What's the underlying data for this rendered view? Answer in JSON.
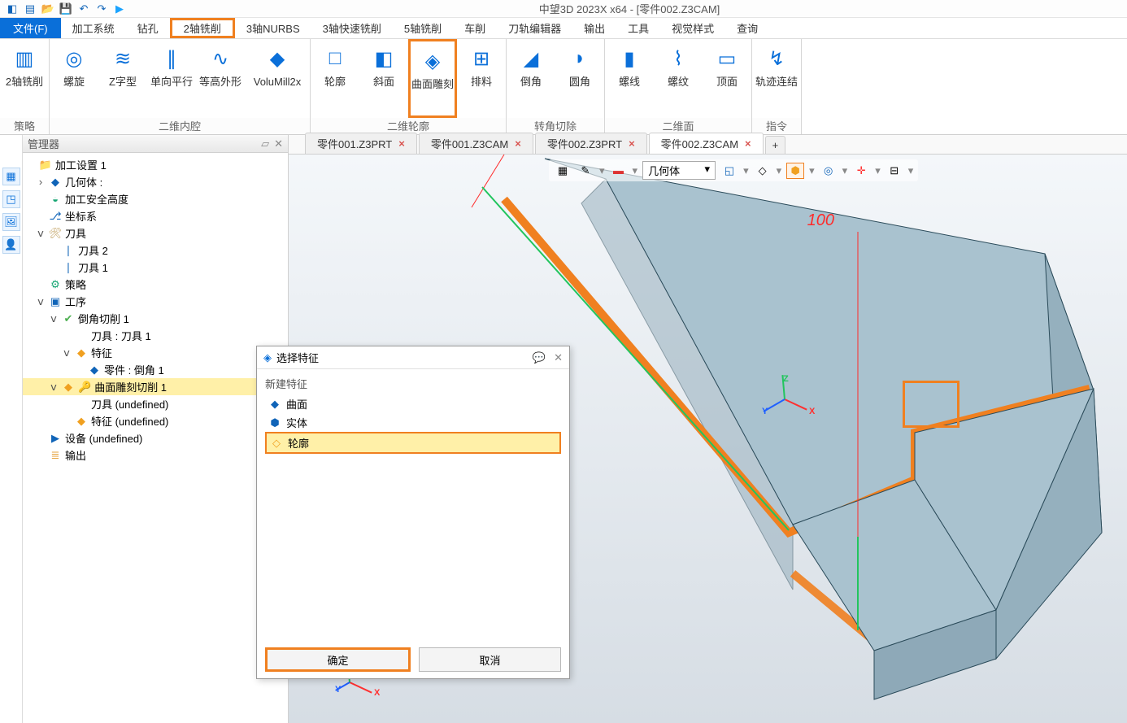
{
  "title": "中望3D 2023X x64 - [零件002.Z3CAM]",
  "file_btn": "文件(F)",
  "menu_tabs": [
    "加工系统",
    "钻孔",
    "2轴铣削",
    "3轴NURBS",
    "3轴快速铣削",
    "5轴铣削",
    "车削",
    "刀轨编辑器",
    "输出",
    "工具",
    "视觉样式",
    "查询"
  ],
  "menu_selected_index": 2,
  "ribbon_groups": [
    {
      "label": "策略",
      "buttons": [
        {
          "cap": "2轴铣削",
          "icon": "▥"
        }
      ]
    },
    {
      "label": "二维内腔",
      "buttons": [
        {
          "cap": "螺旋",
          "icon": "◎"
        },
        {
          "cap": "Z字型",
          "icon": "≋"
        },
        {
          "cap": "单向平行",
          "icon": "∥"
        },
        {
          "cap": "等高外形",
          "icon": "∿"
        },
        {
          "cap": "VoluMill2x",
          "icon": "◆",
          "wide": true
        }
      ]
    },
    {
      "label": "二维轮廓",
      "buttons": [
        {
          "cap": "轮廓",
          "icon": "□"
        },
        {
          "cap": "斜面",
          "icon": "◧"
        },
        {
          "cap": "曲面雕刻",
          "icon": "◈",
          "selected": true
        },
        {
          "cap": "排料",
          "icon": "⊞"
        }
      ]
    },
    {
      "label": "转角切除",
      "buttons": [
        {
          "cap": "倒角",
          "icon": "◢"
        },
        {
          "cap": "圆角",
          "icon": "◗"
        }
      ]
    },
    {
      "label": "二维面",
      "buttons": [
        {
          "cap": "螺线",
          "icon": "▮"
        },
        {
          "cap": "螺纹",
          "icon": "⌇"
        },
        {
          "cap": "顶面",
          "icon": "▭"
        }
      ]
    },
    {
      "label": "指令",
      "buttons": [
        {
          "cap": "轨迹连结",
          "icon": "↯"
        }
      ]
    }
  ],
  "manager_title": "管理器",
  "tree": [
    {
      "d": 0,
      "tw": "",
      "ic": "📁",
      "c": "#e6a23c",
      "t": "加工设置 1"
    },
    {
      "d": 1,
      "tw": "›",
      "ic": "◆",
      "c": "#1064b8",
      "t": "几何体 :"
    },
    {
      "d": 1,
      "tw": "",
      "ic": "◒",
      "c": "#17a673",
      "t": "加工安全高度"
    },
    {
      "d": 1,
      "tw": "",
      "ic": "⎇",
      "c": "#1064b8",
      "t": "坐标系"
    },
    {
      "d": 1,
      "tw": "ⅴ",
      "ic": "🛠",
      "c": "#c0a060",
      "t": "刀具"
    },
    {
      "d": 2,
      "tw": "",
      "ic": "❘",
      "c": "#1064b8",
      "t": "刀具 2"
    },
    {
      "d": 2,
      "tw": "",
      "ic": "❘",
      "c": "#1064b8",
      "t": "刀具 1"
    },
    {
      "d": 1,
      "tw": "",
      "ic": "⚙",
      "c": "#17a673",
      "t": "策略"
    },
    {
      "d": 1,
      "tw": "ⅴ",
      "ic": "▣",
      "c": "#1064b8",
      "t": "工序"
    },
    {
      "d": 2,
      "tw": "ⅴ",
      "ic": "✔",
      "c": "#4caf50",
      "t": "倒角切削 1"
    },
    {
      "d": 3,
      "tw": "",
      "ic": "",
      "c": "",
      "t": "刀具 : 刀具 1"
    },
    {
      "d": 3,
      "tw": "ⅴ",
      "ic": "◆",
      "c": "#f0a020",
      "t": "特征"
    },
    {
      "d": 4,
      "tw": "",
      "ic": "◆",
      "c": "#1064b8",
      "t": "零件 : 倒角 1"
    },
    {
      "d": 2,
      "tw": "ⅴ",
      "ic": "◆",
      "c": "#f0a020",
      "t": "曲面雕刻切削 1",
      "hl": true,
      "extra": "🔑"
    },
    {
      "d": 3,
      "tw": "",
      "ic": "",
      "c": "",
      "t": "刀具 (undefined)"
    },
    {
      "d": 3,
      "tw": "",
      "ic": "◆",
      "c": "#f0a020",
      "t": "特征 (undefined)"
    },
    {
      "d": 1,
      "tw": "",
      "ic": "▶",
      "c": "#1064b8",
      "t": "设备 (undefined)"
    },
    {
      "d": 1,
      "tw": "",
      "ic": "≣",
      "c": "#e6a23c",
      "t": "输出"
    }
  ],
  "doc_tabs": [
    {
      "label": "零件001.Z3PRT",
      "active": false
    },
    {
      "label": "零件001.Z3CAM",
      "active": false
    },
    {
      "label": "零件002.Z3PRT",
      "active": false
    },
    {
      "label": "零件002.Z3CAM",
      "active": true
    }
  ],
  "view_dropdown": "几何体",
  "annotation": "100",
  "dialog": {
    "title": "选择特征",
    "group": "新建特征",
    "items": [
      {
        "icon": "◆",
        "color": "#1064b8",
        "label": "曲面"
      },
      {
        "icon": "⬢",
        "color": "#1064b8",
        "label": "实体"
      },
      {
        "icon": "◇",
        "color": "#f0a020",
        "label": "轮廓",
        "selected": true
      }
    ],
    "ok": "确定",
    "cancel": "取消"
  }
}
